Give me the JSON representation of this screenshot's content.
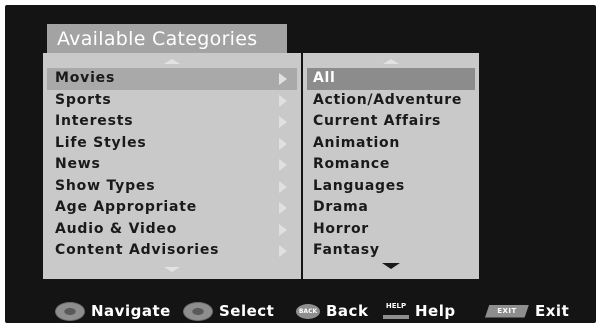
{
  "header": {
    "title": "Available Categories"
  },
  "categories": [
    {
      "label": "Movies",
      "selected": true
    },
    {
      "label": "Sports",
      "selected": false
    },
    {
      "label": "Interests",
      "selected": false
    },
    {
      "label": "Life Styles",
      "selected": false
    },
    {
      "label": "News",
      "selected": false
    },
    {
      "label": "Show Types",
      "selected": false
    },
    {
      "label": "Age Appropriate",
      "selected": false
    },
    {
      "label": "Audio & Video",
      "selected": false
    },
    {
      "label": "Content Advisories",
      "selected": false
    }
  ],
  "subcategories": [
    {
      "label": "All",
      "selected": true
    },
    {
      "label": "Action/Adventure",
      "selected": false
    },
    {
      "label": "Current Affairs",
      "selected": false
    },
    {
      "label": "Animation",
      "selected": false
    },
    {
      "label": "Romance",
      "selected": false
    },
    {
      "label": "Languages",
      "selected": false
    },
    {
      "label": "Drama",
      "selected": false
    },
    {
      "label": "Horror",
      "selected": false
    },
    {
      "label": "Fantasy",
      "selected": false
    }
  ],
  "footer": {
    "navigate": {
      "icon": "dpad-icon",
      "label": "Navigate"
    },
    "select": {
      "icon": "dpad-ok-icon",
      "label": "Select"
    },
    "back": {
      "icon": "back-button-icon",
      "badge": "BACK",
      "label": "Back"
    },
    "help": {
      "icon": "help-button-icon",
      "badge": "HELP",
      "label": "Help"
    },
    "exit": {
      "icon": "exit-button-icon",
      "badge": "EXIT",
      "label": "Exit"
    }
  },
  "colors": {
    "background": "#141414",
    "panel": "#c9c9c9",
    "title_tab": "#a3a3a3",
    "category_highlight": "#a9a9a9",
    "subcategory_highlight": "#8c8c8c",
    "text": "#1a1a1a",
    "footer_text": "#ffffff"
  }
}
